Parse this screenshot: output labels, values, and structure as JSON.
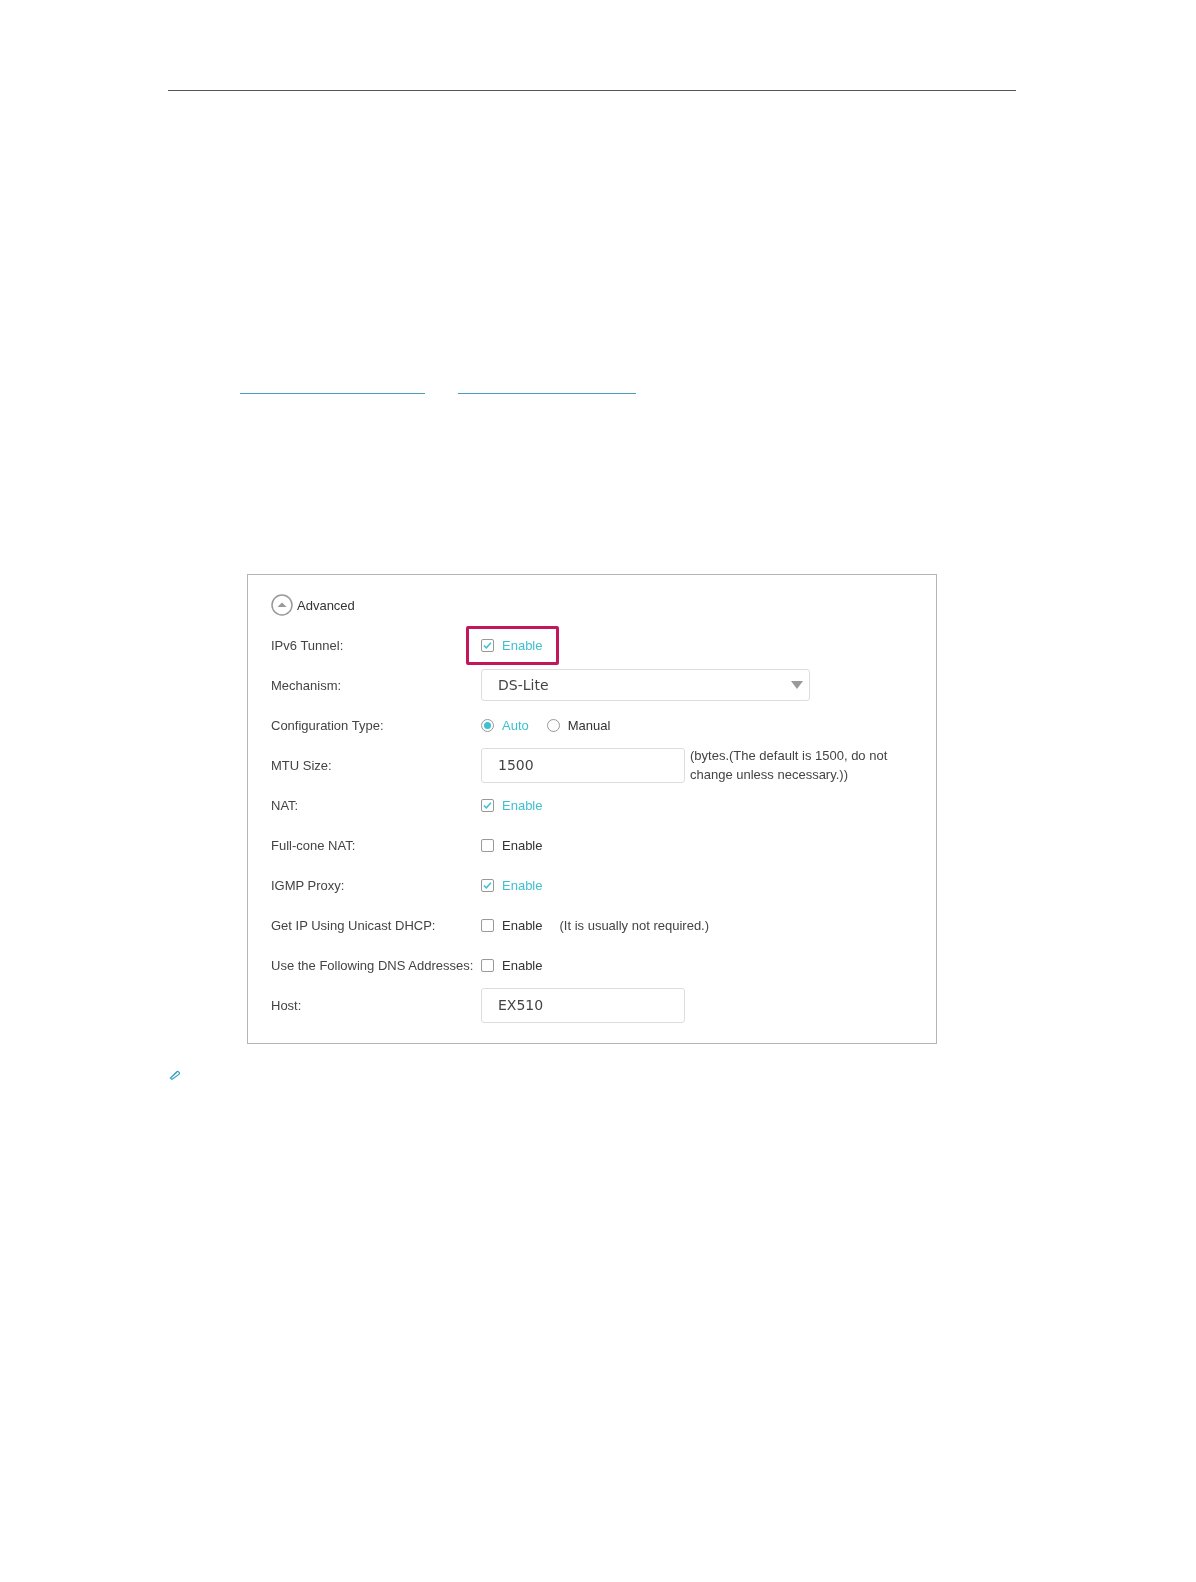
{
  "panel": {
    "toggle": {
      "label": "Advanced",
      "expanded": true
    },
    "fields": [
      {
        "kind": "checkbox",
        "label": "IPv6 Tunnel:",
        "option": "Enable",
        "checked": true,
        "highlighted": true
      },
      {
        "kind": "select",
        "label": "Mechanism:",
        "value": "DS-Lite"
      },
      {
        "kind": "radio",
        "label": "Configuration Type:",
        "options": [
          {
            "label": "Auto",
            "selected": true
          },
          {
            "label": "Manual",
            "selected": false
          }
        ]
      },
      {
        "kind": "input",
        "label": "MTU Size:",
        "value": "1500",
        "note": "(bytes.(The default is 1500, do not change unless necessary.))"
      },
      {
        "kind": "checkbox",
        "label": "NAT:",
        "option": "Enable",
        "checked": true
      },
      {
        "kind": "checkbox",
        "label": "Full-cone NAT:",
        "option": "Enable",
        "checked": false
      },
      {
        "kind": "checkbox",
        "label": "IGMP Proxy:",
        "option": "Enable",
        "checked": true
      },
      {
        "kind": "checkbox",
        "label": "Get IP Using Unicast DHCP:",
        "option": "Enable",
        "checked": false,
        "note": "(It is usually not required.)"
      },
      {
        "kind": "checkbox",
        "label": "Use the Following DNS Addresses:",
        "option": "Enable",
        "checked": false
      },
      {
        "kind": "input",
        "label": "Host:",
        "value": "EX510"
      }
    ]
  }
}
